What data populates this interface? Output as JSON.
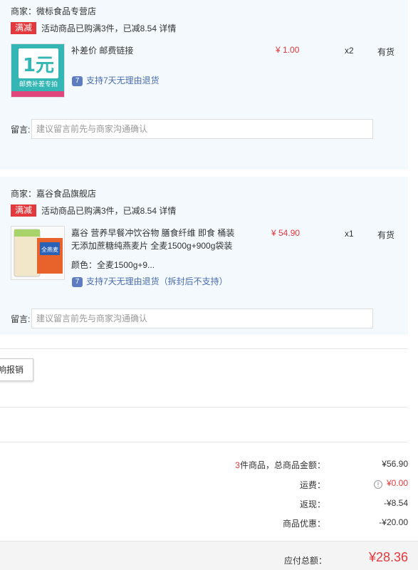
{
  "stores": [
    {
      "merchant": "商家：微标食品专营店",
      "promo_tag": "满减",
      "promo_text": "活动商品已购满3件，已减8.54",
      "promo_link": "详情",
      "item": {
        "name_line1": "补差价 邮费链接",
        "price": "¥ 1.00",
        "qty": "x2",
        "stock": "有货",
        "guarantee": "支持7天无理由退货",
        "thumb_big": "1元",
        "thumb_caption": "邮费补差专拍"
      },
      "note_label": "留言:",
      "note_placeholder": "建议留言前先与商家沟通确认"
    },
    {
      "merchant": "商家：嘉谷食品旗舰店",
      "promo_tag": "满减",
      "promo_text": "活动商品已购满3件，已减8.54",
      "promo_link": "详情",
      "item": {
        "name_line1": "嘉谷 营养早餐冲饮谷物 膳食纤维 即食 桶装",
        "name_line2": "无添加蔗糖纯燕麦片 全麦1500g+900g袋装",
        "variant": "颜色：全麦1500g+9...",
        "price": "¥ 54.90",
        "qty": "x1",
        "stock": "有货",
        "guarantee": "支持7天无理由退货（拆封后不支持）",
        "thumb_text": "全燕麦"
      },
      "note_label": "留言:",
      "note_placeholder": "建议留言前先与商家沟通确认"
    }
  ],
  "invoice_button": "响报销",
  "summary": {
    "count": "3",
    "count_suffix": "件商品，总商品金额：",
    "goods_total": "¥56.90",
    "shipping_label": "运费：",
    "shipping_value": "¥0.00",
    "cashback_label": "返现：",
    "cashback_value": "-¥8.54",
    "discount_label": "商品优惠：",
    "discount_value": "-¥20.00",
    "total_label": "应付总额：",
    "total_value": "¥28.36"
  },
  "colors": {
    "accent_red": "#e4393c",
    "store_bg": "#f3f9fd",
    "guarantee_blue": "#4a6db0"
  }
}
